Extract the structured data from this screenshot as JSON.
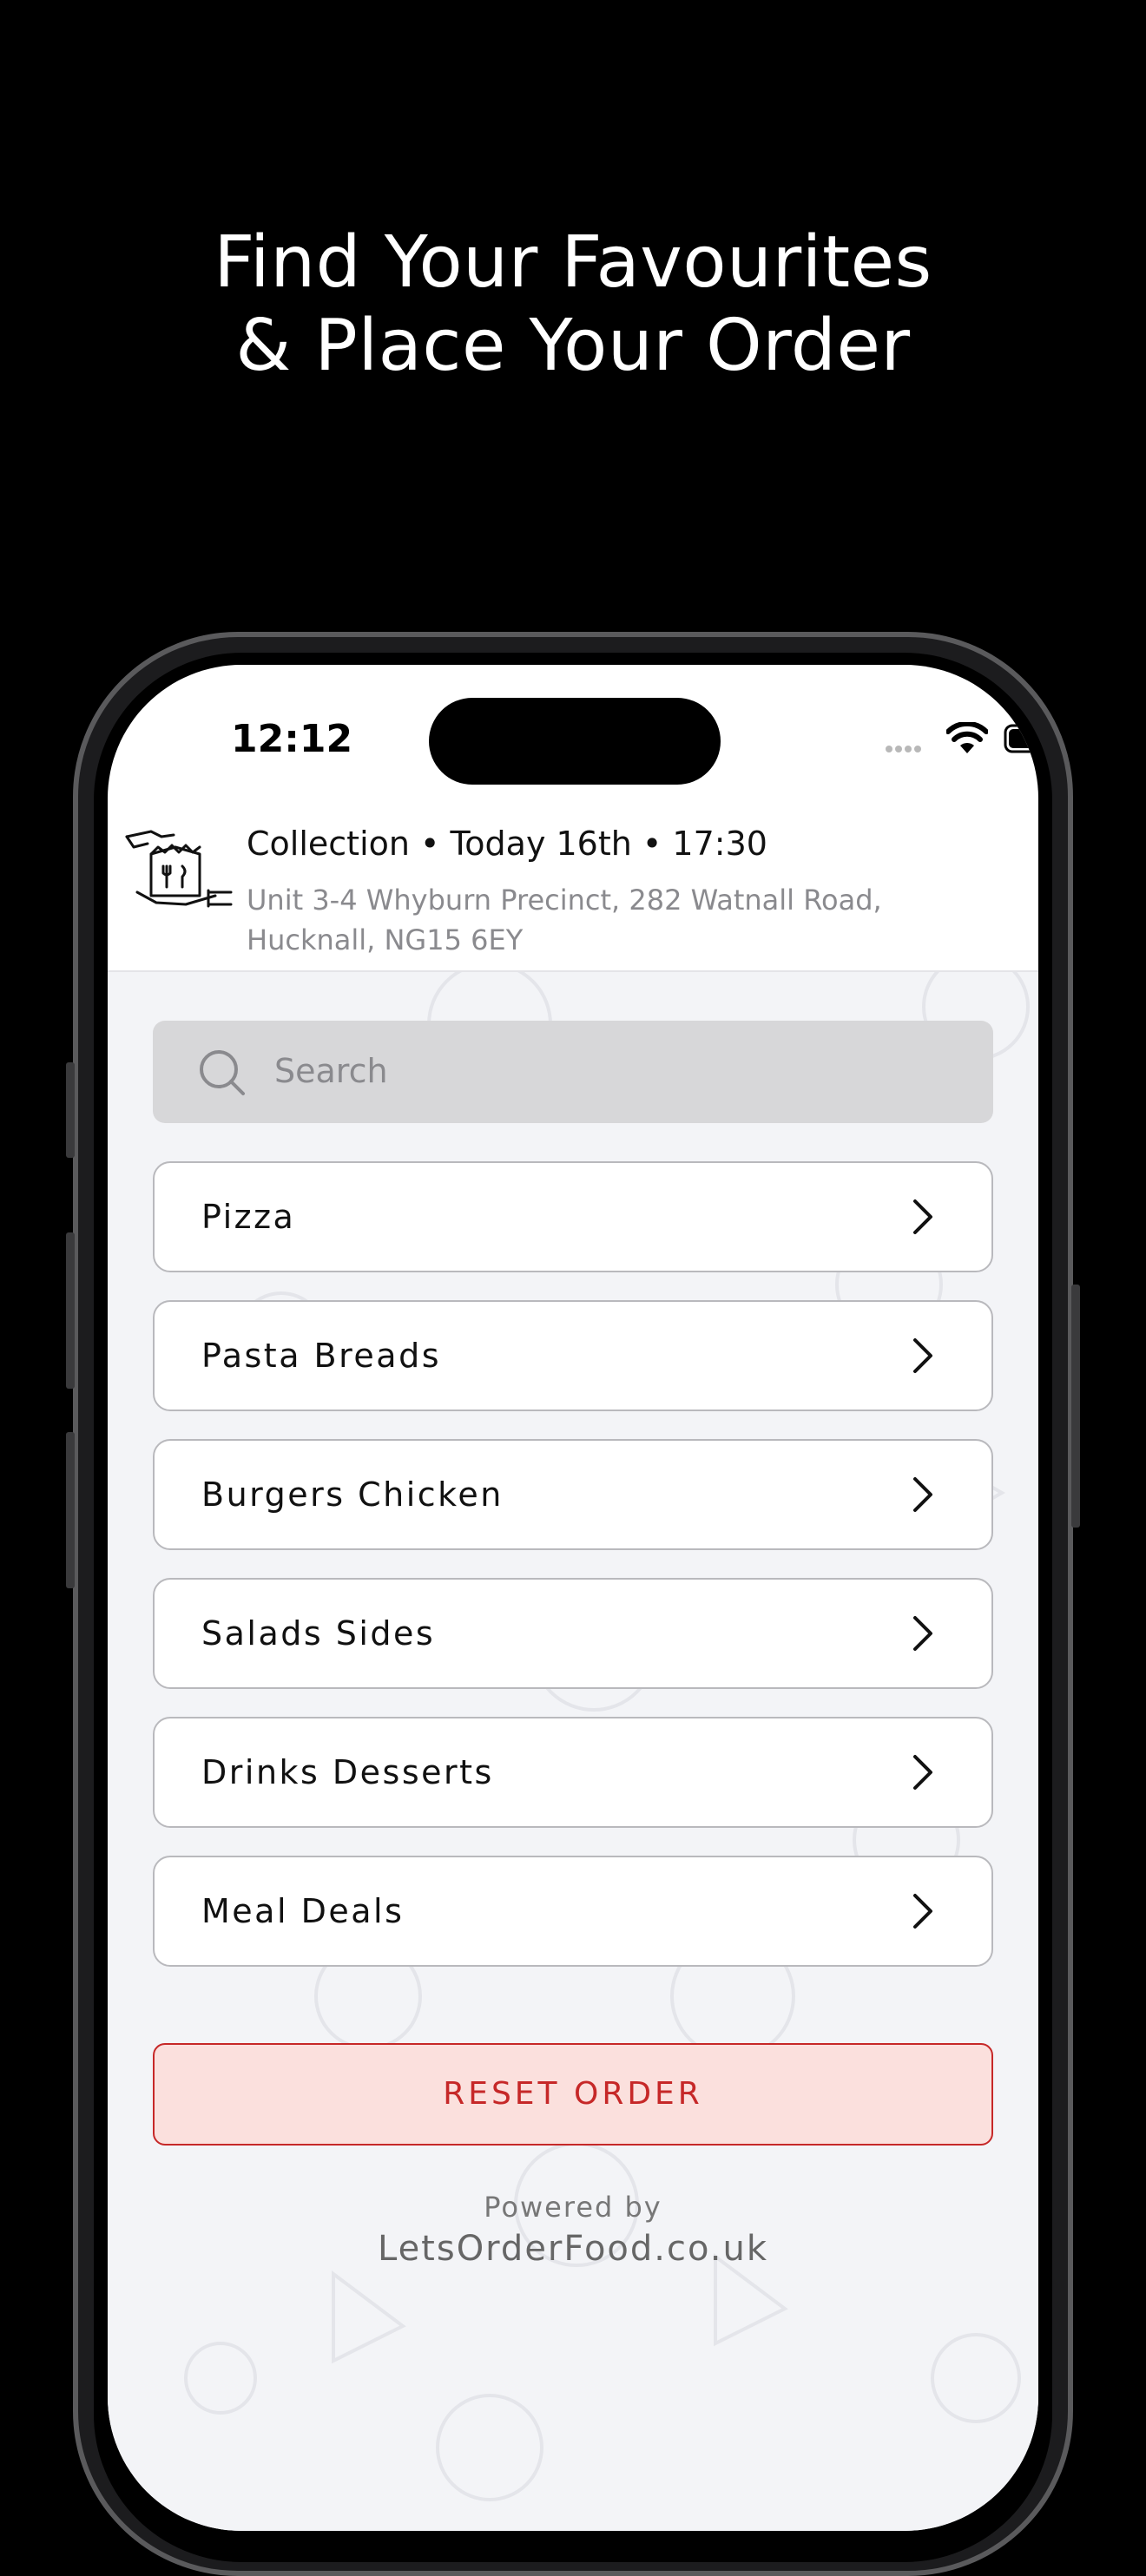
{
  "promo": {
    "line1": "Find Your Favourites",
    "line2": "& Place Your Order"
  },
  "status_bar": {
    "time": "12:12"
  },
  "header": {
    "title": "Collection  •  Today 16th  •  17:30",
    "address_line1": "Unit 3-4 Whyburn Precinct, 282 Watnall Road,",
    "address_line2": "Hucknall, NG15  6EY",
    "icon": "collection-bag-icon"
  },
  "search": {
    "placeholder": "Search",
    "icon": "search-icon"
  },
  "categories": [
    {
      "label": "Pizza"
    },
    {
      "label": "Pasta Breads"
    },
    {
      "label": "Burgers Chicken"
    },
    {
      "label": "Salads Sides"
    },
    {
      "label": "Drinks Desserts"
    },
    {
      "label": "Meal Deals"
    }
  ],
  "reset_button": {
    "label": "RESET ORDER"
  },
  "footer": {
    "powered_by": "Powered by",
    "site": "LetsOrderFood.co.uk"
  },
  "colors": {
    "accent_red": "#c62828",
    "reset_bg": "#fbe0dd",
    "content_bg": "#f3f4f7"
  }
}
